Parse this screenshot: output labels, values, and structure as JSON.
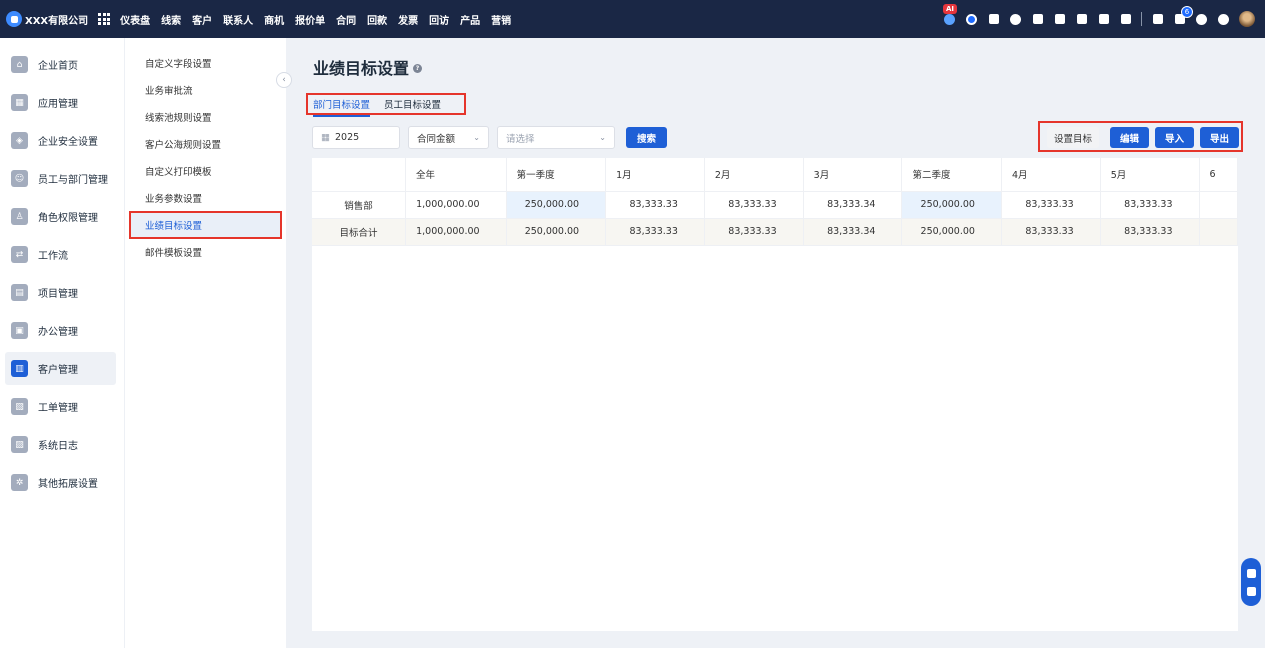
{
  "brand": {
    "name": "XXX有限公司"
  },
  "nav": [
    "仪表盘",
    "线索",
    "客户",
    "联系人",
    "商机",
    "报价单",
    "合同",
    "回款",
    "发票",
    "回访",
    "产品",
    "营销"
  ],
  "top_icons": {
    "ai_badge": "AI",
    "notification_count": "6"
  },
  "sidebar": {
    "items": [
      {
        "label": "企业首页",
        "icon": "home-icon",
        "glyph": "⌂"
      },
      {
        "label": "应用管理",
        "icon": "apps-icon",
        "glyph": "▦"
      },
      {
        "label": "企业安全设置",
        "icon": "shield-icon",
        "glyph": "◈"
      },
      {
        "label": "员工与部门管理",
        "icon": "users-icon",
        "glyph": "☺"
      },
      {
        "label": "角色权限管理",
        "icon": "role-icon",
        "glyph": "♙"
      },
      {
        "label": "工作流",
        "icon": "workflow-icon",
        "glyph": "⇄"
      },
      {
        "label": "项目管理",
        "icon": "project-icon",
        "glyph": "▤"
      },
      {
        "label": "办公管理",
        "icon": "office-icon",
        "glyph": "▣"
      },
      {
        "label": "客户管理",
        "icon": "customer-icon",
        "glyph": "▥"
      },
      {
        "label": "工单管理",
        "icon": "ticket-icon",
        "glyph": "▧"
      },
      {
        "label": "系统日志",
        "icon": "log-icon",
        "glyph": "▨"
      },
      {
        "label": "其他拓展设置",
        "icon": "extension-icon",
        "glyph": "✲"
      }
    ],
    "active_index": 8
  },
  "submenu": {
    "items": [
      "自定义字段设置",
      "业务审批流",
      "线索池规则设置",
      "客户公海规则设置",
      "自定义打印模板",
      "业务参数设置",
      "业绩目标设置",
      "邮件模板设置"
    ],
    "active_index": 6
  },
  "page": {
    "title": "业绩目标设置",
    "tabs": [
      "部门目标设置",
      "员工目标设置"
    ],
    "active_tab": 0
  },
  "filters": {
    "year": "2025",
    "amount_type": "合同金额",
    "select_placeholder": "请选择",
    "search_label": "搜索"
  },
  "actions": {
    "set_target": "设置目标",
    "edit": "编辑",
    "import": "导入",
    "export": "导出"
  },
  "table": {
    "columns": [
      "",
      "全年",
      "第一季度",
      "1月",
      "2月",
      "3月",
      "第二季度",
      "4月",
      "5月",
      "6"
    ],
    "rows": [
      {
        "label": "销售部",
        "values": [
          "1,000,000.00",
          "250,000.00",
          "83,333.33",
          "83,333.33",
          "83,333.34",
          "250,000.00",
          "83,333.33",
          "83,333.33",
          ""
        ]
      },
      {
        "label": "目标合计",
        "values": [
          "1,000,000.00",
          "250,000.00",
          "83,333.33",
          "83,333.33",
          "83,333.34",
          "250,000.00",
          "83,333.33",
          "83,333.33",
          ""
        ]
      }
    ]
  },
  "colors": {
    "topbar": "#1a2745",
    "primary": "#1e5fd6",
    "highlight_border": "#e5352b"
  }
}
